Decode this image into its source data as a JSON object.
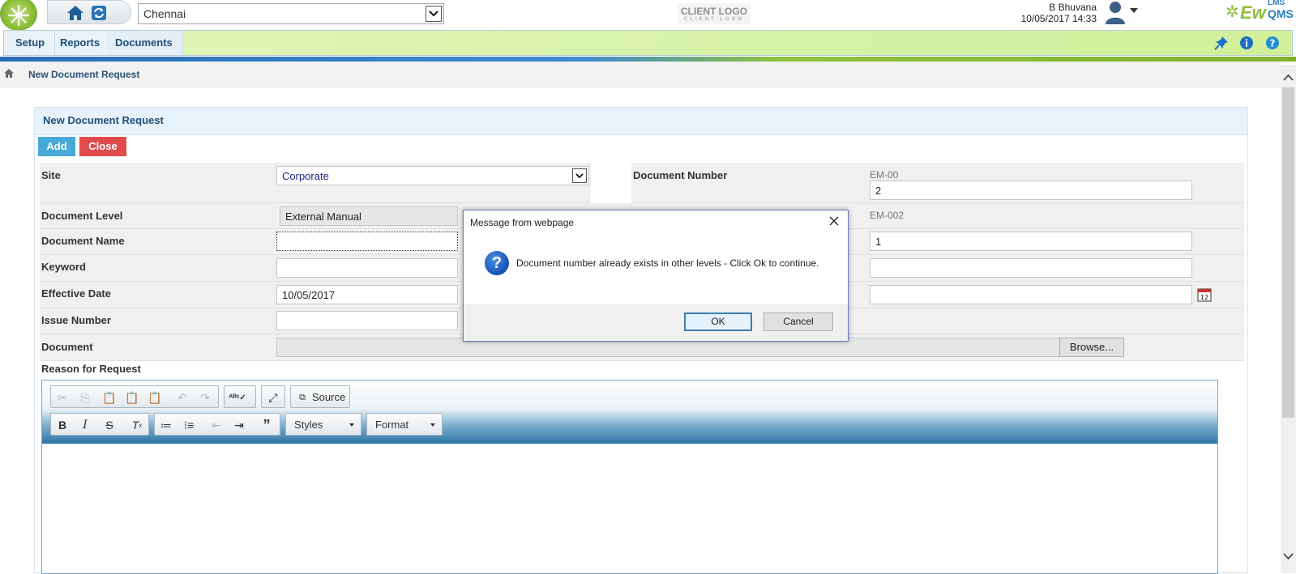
{
  "header": {
    "site_value": "Chennai",
    "client_logo": "CLIENT LOGO",
    "client_logo_sub": "CLIENT LOGO",
    "user_name": "B Bhuvana",
    "datetime": "10/05/2017 14:33",
    "brand_main": "Ew",
    "brand_qms": "QMS",
    "brand_lms": "LMS"
  },
  "menu": {
    "items": [
      "Setup",
      "Reports",
      "Documents"
    ]
  },
  "breadcrumb": {
    "current": "New Document Request"
  },
  "panel": {
    "title": "New Document Request",
    "add_label": "Add",
    "close_label": "Close"
  },
  "form": {
    "site_label": "Site",
    "site_value": "Corporate",
    "doc_number_label": "Document Number",
    "doc_number_prefix": "EM-00",
    "doc_number_value": "2",
    "doc_level_label": "Document Level",
    "doc_level_value": "External Manual",
    "doc_level_code": "EM-002",
    "doc_name_label": "Document Name",
    "doc_name_value": "",
    "right_field_1_value": "1",
    "keyword_label": "Keyword",
    "keyword_value": "",
    "effective_date_label": "Effective Date",
    "effective_date_value": "10/05/2017",
    "issue_number_label": "Issue Number",
    "issue_number_value": "",
    "document_label": "Document",
    "browse_label": "Browse...",
    "reason_label": "Reason for Request"
  },
  "editor": {
    "source_label": "Source",
    "styles_label": "Styles",
    "format_label": "Format"
  },
  "dialog": {
    "title": "Message from webpage",
    "message": "Document number already exists in other levels - Click Ok to continue.",
    "ok_label": "OK",
    "cancel_label": "Cancel"
  },
  "colors": {
    "accent_blue": "#1f4f7a",
    "add_button": "#46a9d6",
    "close_button": "#e04b4b",
    "menu_green": "#d2ef9a"
  }
}
